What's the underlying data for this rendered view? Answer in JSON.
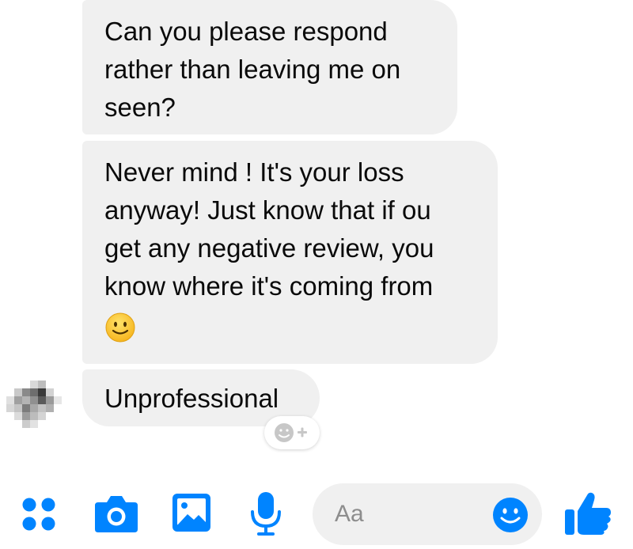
{
  "conversation": {
    "messages": [
      {
        "lines": [
          "Can you please respond",
          "rather than leaving me on",
          "seen?"
        ]
      },
      {
        "lines": [
          "Never mind ! It's your loss",
          "anyway! Just know that if ou",
          "get any negative review, you",
          "know where it's coming from"
        ],
        "emoji": "slightly-smiling-face"
      },
      {
        "lines": [
          "Unprofessional"
        ]
      }
    ],
    "react_button": {
      "icon": "add-reaction-icon"
    }
  },
  "composer": {
    "placeholder": "Aa",
    "tools": [
      "apps-icon",
      "camera-icon",
      "photo-icon",
      "microphone-icon"
    ],
    "emoji_icon": "smiley-icon",
    "send_icon": "thumbs-up-icon"
  },
  "colors": {
    "accent": "#0084ff",
    "bubble": "#f0f0f0",
    "composer_bg": "#f0f0f0",
    "text": "#0a0a0a",
    "placeholder": "#8d8d8d"
  }
}
